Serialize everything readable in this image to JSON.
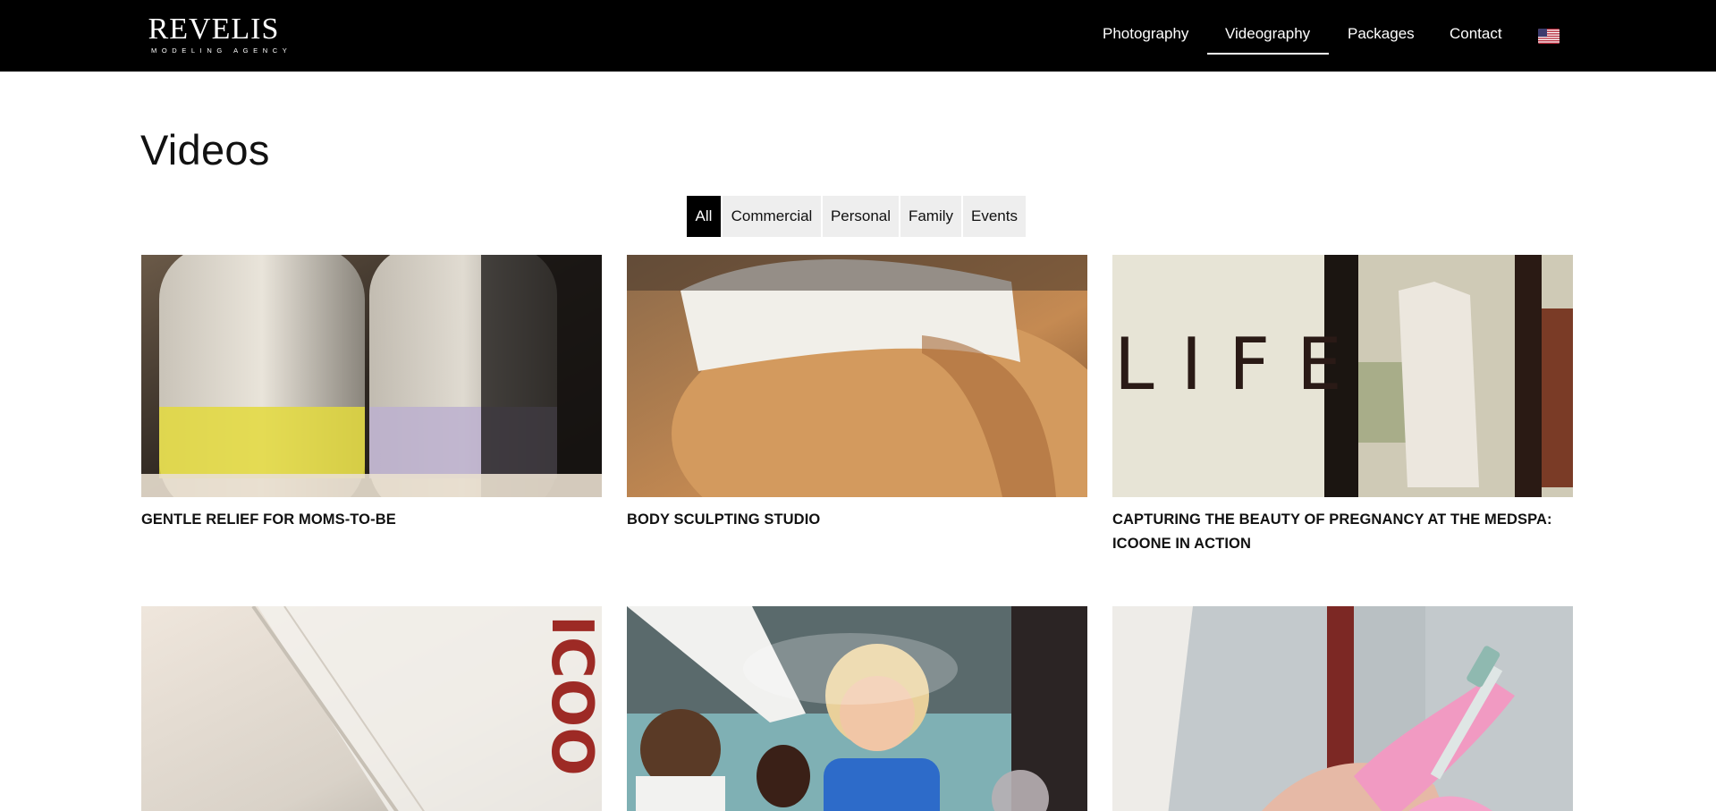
{
  "header": {
    "logo_main": "REVELIS",
    "logo_sub": "MODELING AGENCY",
    "nav": [
      {
        "label": "Photography"
      },
      {
        "label": "Videography",
        "active": true
      },
      {
        "label": "Packages"
      },
      {
        "label": "Contact"
      }
    ],
    "language_icon": "us-flag-icon"
  },
  "page": {
    "title": "Videos"
  },
  "filters": [
    {
      "label": "All",
      "active": true
    },
    {
      "label": "Commercial"
    },
    {
      "label": "Personal"
    },
    {
      "label": "Family"
    },
    {
      "label": "Events"
    }
  ],
  "videos": [
    {
      "title": "GENTLE RELIEF FOR MOMS-TO-BE"
    },
    {
      "title": "BODY SCULPTING STUDIO"
    },
    {
      "title": "CAPTURING THE BEAUTY OF PREGNANCY AT THE MEDSPA: ICOONE IN ACTION",
      "thumb_text": "LIFE"
    },
    {
      "title": "",
      "thumb_text": "ICOO"
    },
    {
      "title": ""
    },
    {
      "title": ""
    }
  ],
  "colors": {
    "header_bg": "#000000",
    "active_filter_bg": "#000000",
    "filter_bg": "#eeeeee"
  }
}
